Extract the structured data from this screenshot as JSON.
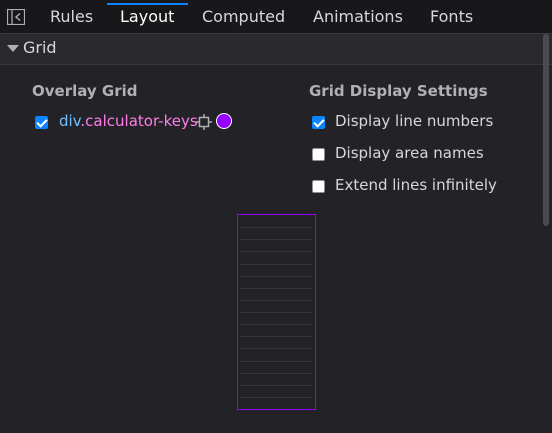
{
  "tabs": [
    {
      "label": "Rules",
      "selected": false
    },
    {
      "label": "Layout",
      "selected": true
    },
    {
      "label": "Computed",
      "selected": false
    },
    {
      "label": "Animations",
      "selected": false
    },
    {
      "label": "Fonts",
      "selected": false
    }
  ],
  "grid_section": {
    "title": "Grid",
    "overlay": {
      "heading": "Overlay Grid",
      "item": {
        "element": "div",
        "class_text": ".calculator-keys",
        "checked": true,
        "color": "#9400ff"
      }
    },
    "display_settings": {
      "heading": "Grid Display Settings",
      "options": [
        {
          "label": "Display line numbers",
          "checked": true
        },
        {
          "label": "Display area names",
          "checked": false
        },
        {
          "label": "Extend lines infinitely",
          "checked": false
        }
      ]
    },
    "outline": {
      "rows": 16,
      "color": "#9400ff"
    }
  },
  "colors": {
    "accent": "#0a84ff",
    "overlay": "#9400ff",
    "element_name": "#75bfff",
    "class_name": "#ff7de9"
  }
}
